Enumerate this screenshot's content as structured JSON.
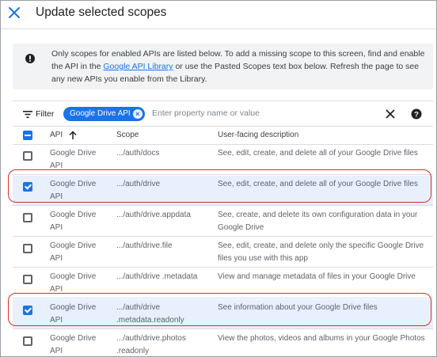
{
  "header": {
    "title": "Update selected scopes"
  },
  "banner": {
    "text_before": "Only scopes for enabled APIs are listed below. To add a missing scope to this screen, find and enable the API in the ",
    "link": "Google API Library",
    "text_after": " or use the Pasted Scopes text box below. Refresh the page to see any new APIs you enable from the Library."
  },
  "filter": {
    "label": "Filter",
    "chip": "Google Drive API",
    "placeholder": "Enter property name or value"
  },
  "table": {
    "columns": [
      "API",
      "Scope",
      "User-facing description"
    ],
    "rows": [
      {
        "checked": false,
        "api": "Google Drive API",
        "scope": ".../auth/docs",
        "description": "See, edit, create, and delete all of your Google Drive files"
      },
      {
        "checked": true,
        "api": "Google Drive API",
        "scope": ".../auth/drive",
        "description": "See, edit, create, and delete all of your Google Drive files"
      },
      {
        "checked": false,
        "api": "Google Drive API",
        "scope": ".../auth/drive.appdata",
        "description": "See, create, and delete its own configuration data in your Google Drive"
      },
      {
        "checked": false,
        "api": "Google Drive API",
        "scope": ".../auth/drive.file",
        "description": "See, edit, create, and delete only the specific Google Drive files you use with this app"
      },
      {
        "checked": false,
        "api": "Google Drive API",
        "scope": ".../auth/drive .metadata",
        "description": "View and manage metadata of files in your Google Drive"
      },
      {
        "checked": true,
        "api": "Google Drive API",
        "scope": ".../auth/drive .metadata.readonly",
        "description": "See information about your Google Drive files"
      },
      {
        "checked": false,
        "api": "Google Drive API",
        "scope": ".../auth/drive.photos .readonly",
        "description": "View the photos, videos and albums in your Google Photos"
      }
    ]
  },
  "colors": {
    "accent": "#1a73e8",
    "highlight": "#d93025",
    "selected_row": "#e8f0fe"
  },
  "icons": [
    "close-icon",
    "info-icon",
    "filter-icon",
    "chip-remove-icon",
    "clear-filter-icon",
    "help-icon",
    "sort-arrow-up-icon"
  ]
}
